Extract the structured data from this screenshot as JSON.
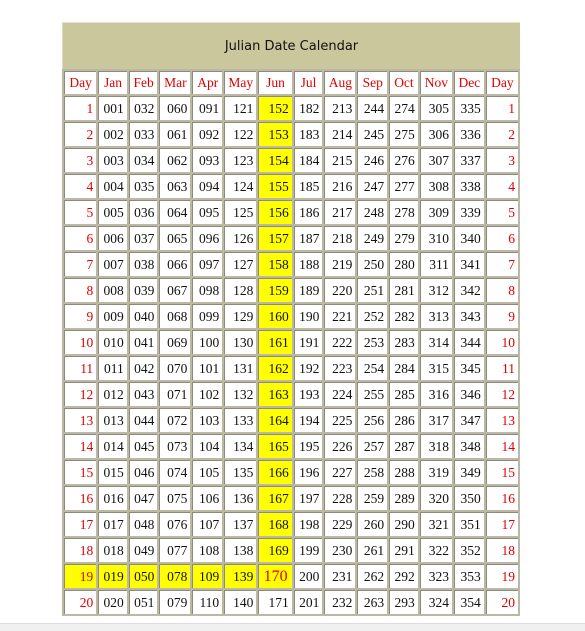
{
  "title": "Julian Date Calendar",
  "headers": [
    "Day",
    "Jan",
    "Feb",
    "Mar",
    "Apr",
    "May",
    "Jun",
    "Jul",
    "Aug",
    "Sep",
    "Oct",
    "Nov",
    "Dec",
    "Day"
  ],
  "highlight": {
    "color": "#ffff00",
    "column": "Jun",
    "row_day": 19,
    "emphasized_cell": "170"
  },
  "colors": {
    "day_text": "#e00000",
    "title_bg": "#c9c79b",
    "grid": "#bcb8a6"
  },
  "rows": [
    {
      "day": "1",
      "values": [
        "001",
        "032",
        "060",
        "091",
        "121",
        "152",
        "182",
        "213",
        "244",
        "274",
        "305",
        "335"
      ]
    },
    {
      "day": "2",
      "values": [
        "002",
        "033",
        "061",
        "092",
        "122",
        "153",
        "183",
        "214",
        "245",
        "275",
        "306",
        "336"
      ]
    },
    {
      "day": "3",
      "values": [
        "003",
        "034",
        "062",
        "093",
        "123",
        "154",
        "184",
        "215",
        "246",
        "276",
        "307",
        "337"
      ]
    },
    {
      "day": "4",
      "values": [
        "004",
        "035",
        "063",
        "094",
        "124",
        "155",
        "185",
        "216",
        "247",
        "277",
        "308",
        "338"
      ]
    },
    {
      "day": "5",
      "values": [
        "005",
        "036",
        "064",
        "095",
        "125",
        "156",
        "186",
        "217",
        "248",
        "278",
        "309",
        "339"
      ]
    },
    {
      "day": "6",
      "values": [
        "006",
        "037",
        "065",
        "096",
        "126",
        "157",
        "187",
        "218",
        "249",
        "279",
        "310",
        "340"
      ]
    },
    {
      "day": "7",
      "values": [
        "007",
        "038",
        "066",
        "097",
        "127",
        "158",
        "188",
        "219",
        "250",
        "280",
        "311",
        "341"
      ]
    },
    {
      "day": "8",
      "values": [
        "008",
        "039",
        "067",
        "098",
        "128",
        "159",
        "189",
        "220",
        "251",
        "281",
        "312",
        "342"
      ]
    },
    {
      "day": "9",
      "values": [
        "009",
        "040",
        "068",
        "099",
        "129",
        "160",
        "190",
        "221",
        "252",
        "282",
        "313",
        "343"
      ]
    },
    {
      "day": "10",
      "values": [
        "010",
        "041",
        "069",
        "100",
        "130",
        "161",
        "191",
        "222",
        "253",
        "283",
        "314",
        "344"
      ]
    },
    {
      "day": "11",
      "values": [
        "011",
        "042",
        "070",
        "101",
        "131",
        "162",
        "192",
        "223",
        "254",
        "284",
        "315",
        "345"
      ]
    },
    {
      "day": "12",
      "values": [
        "012",
        "043",
        "071",
        "102",
        "132",
        "163",
        "193",
        "224",
        "255",
        "285",
        "316",
        "346"
      ]
    },
    {
      "day": "13",
      "values": [
        "013",
        "044",
        "072",
        "103",
        "133",
        "164",
        "194",
        "225",
        "256",
        "286",
        "317",
        "347"
      ]
    },
    {
      "day": "14",
      "values": [
        "014",
        "045",
        "073",
        "104",
        "134",
        "165",
        "195",
        "226",
        "257",
        "287",
        "318",
        "348"
      ]
    },
    {
      "day": "15",
      "values": [
        "015",
        "046",
        "074",
        "105",
        "135",
        "166",
        "196",
        "227",
        "258",
        "288",
        "319",
        "349"
      ]
    },
    {
      "day": "16",
      "values": [
        "016",
        "047",
        "075",
        "106",
        "136",
        "167",
        "197",
        "228",
        "259",
        "289",
        "320",
        "350"
      ]
    },
    {
      "day": "17",
      "values": [
        "017",
        "048",
        "076",
        "107",
        "137",
        "168",
        "198",
        "229",
        "260",
        "290",
        "321",
        "351"
      ]
    },
    {
      "day": "18",
      "values": [
        "018",
        "049",
        "077",
        "108",
        "138",
        "169",
        "199",
        "230",
        "261",
        "291",
        "322",
        "352"
      ]
    },
    {
      "day": "19",
      "values": [
        "019",
        "050",
        "078",
        "109",
        "139",
        "170",
        "200",
        "231",
        "262",
        "292",
        "323",
        "353"
      ]
    },
    {
      "day": "20",
      "values": [
        "020",
        "051",
        "079",
        "110",
        "140",
        "171",
        "201",
        "232",
        "263",
        "293",
        "324",
        "354"
      ]
    }
  ]
}
